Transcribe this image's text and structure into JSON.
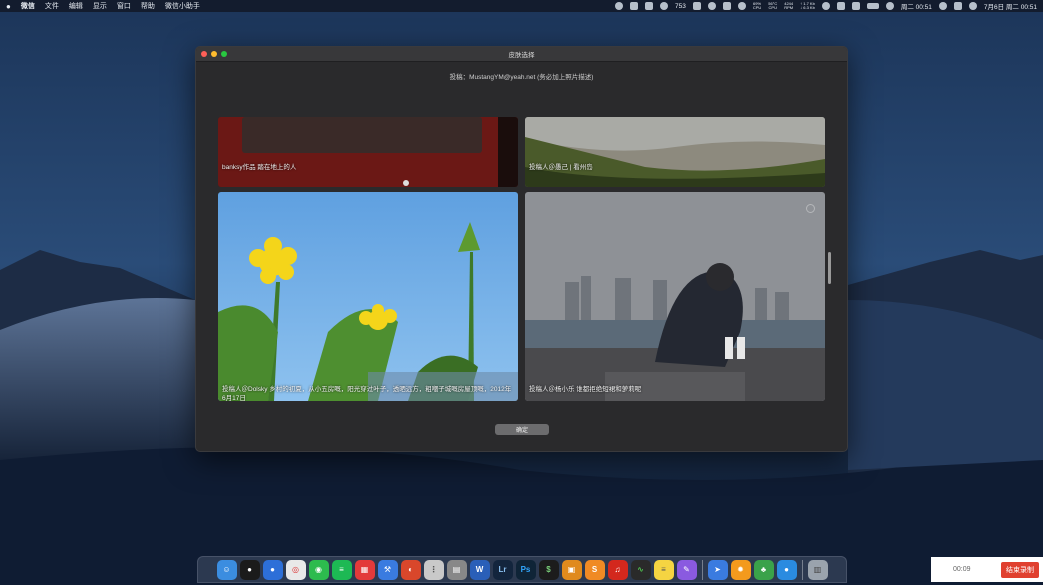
{
  "menubar": {
    "apple_icon": "apple-icon",
    "app_name": "微信",
    "menus": [
      "文件",
      "编辑",
      "显示",
      "窗口",
      "帮助",
      "微信小助手"
    ],
    "status": {
      "badge_count": "753",
      "cpu": "69%",
      "cpu_sub": "CPU",
      "temp": "56°C",
      "temp_sub": "CPU",
      "rpm": "4244",
      "rpm_sub": "RPM",
      "net_up": "↑ 1.7 Kb",
      "net_down": "↓ 6.3 Kb",
      "day": "周二 00:51",
      "date": "7月6日 周二 00:51"
    }
  },
  "window": {
    "title": "皮肤选择",
    "notice": "投稿：MustangYM@yeah.net (务必加上照片描述)",
    "cards": [
      {
        "caption": "banksy作品 踏在地上的人"
      },
      {
        "caption": "投稿人＠愚己 | 看州岛"
      },
      {
        "caption": "投稿人＠Dolsky 乡村的初夏，从小五房嘅，阳光穿过叶子，透晒远方，粗嗰子城嘅房屋顶嘅，2012年6月17日"
      },
      {
        "caption": "投稿人＠杨小乐 谁都拒绝短裙和萝莉呢"
      }
    ],
    "confirm_label": "确定"
  },
  "recorder": {
    "time": "00:09",
    "stop_label": "结束录制"
  },
  "colors": {
    "close": "#fe5f57",
    "minimize": "#febc2e",
    "zoom": "#28c840",
    "stop": "#e0402f"
  }
}
